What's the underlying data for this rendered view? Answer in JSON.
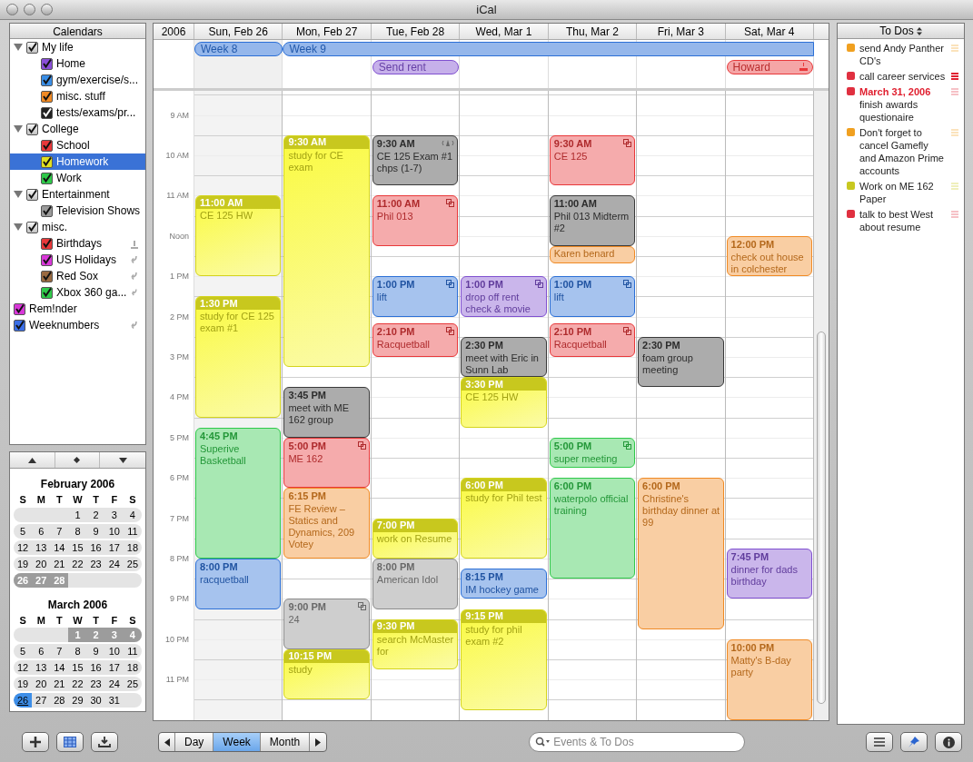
{
  "window": {
    "title": "iCal"
  },
  "calendars": {
    "title": "Calendars",
    "items": [
      {
        "label": "My life",
        "kind": "group",
        "expanded": true,
        "checked": true,
        "selected": false,
        "children": [
          {
            "label": "Home",
            "kind": "local",
            "checked": true,
            "color": "#8a4fd8",
            "selected": false
          },
          {
            "label": "gym/exercise/s...",
            "kind": "local",
            "checked": true,
            "color": "#3a8ee6",
            "selected": false
          },
          {
            "label": "misc. stuff",
            "kind": "local",
            "checked": true,
            "color": "#f08a24",
            "selected": false
          },
          {
            "label": "tests/exams/pr...",
            "kind": "local",
            "checked": true,
            "color": "#222222",
            "selected": false
          }
        ]
      },
      {
        "label": "College",
        "kind": "group",
        "expanded": true,
        "checked": true,
        "selected": false,
        "children": [
          {
            "label": "School",
            "kind": "local",
            "checked": true,
            "color": "#e8383a",
            "selected": false
          },
          {
            "label": "Homework",
            "kind": "local",
            "checked": true,
            "color": "#e0e020",
            "selected": true
          },
          {
            "label": "Work",
            "kind": "local",
            "checked": true,
            "color": "#2fc94a",
            "selected": false
          }
        ]
      },
      {
        "label": "Entertainment",
        "kind": "group",
        "expanded": true,
        "checked": true,
        "selected": false,
        "children": [
          {
            "label": "Television Shows",
            "kind": "local",
            "checked": true,
            "color": "#9a9a9a",
            "selected": false
          }
        ]
      },
      {
        "label": "misc.",
        "kind": "group",
        "expanded": true,
        "checked": true,
        "selected": false,
        "children": [
          {
            "label": "Birthdays",
            "kind": "birthdays",
            "checked": true,
            "color": "#e8383a",
            "selected": false
          },
          {
            "label": "US Holidays",
            "kind": "subscribed",
            "checked": true,
            "color": "#d838d8",
            "selected": false
          },
          {
            "label": "Red Sox",
            "kind": "subscribed",
            "checked": true,
            "color": "#9a6a40",
            "selected": false
          },
          {
            "label": "Xbox 360 ga...",
            "kind": "subscribed",
            "checked": true,
            "color": "#2fc94a",
            "selected": false
          }
        ]
      },
      {
        "label": "Rem!nder",
        "kind": "local",
        "checked": true,
        "color": "#d838d8",
        "selected": false
      },
      {
        "label": "Weeknumbers",
        "kind": "subscribed",
        "checked": true,
        "color": "#3a6ee6",
        "selected": false
      }
    ]
  },
  "mini_calendars": [
    {
      "title": "February 2006",
      "weekdays": [
        "S",
        "M",
        "T",
        "W",
        "T",
        "F",
        "S"
      ],
      "weeks": [
        [
          {
            "label": "1",
            "selected": false,
            "today": false
          },
          {
            "label": "2",
            "selected": false,
            "today": false
          },
          {
            "label": "3",
            "selected": false,
            "today": false
          },
          {
            "label": "4",
            "selected": false,
            "today": false
          }
        ],
        [
          {
            "label": "5",
            "selected": false,
            "today": false
          },
          {
            "label": "6",
            "selected": false,
            "today": false
          },
          {
            "label": "7",
            "selected": false,
            "today": false
          },
          {
            "label": "8",
            "selected": false,
            "today": false
          },
          {
            "label": "9",
            "selected": false,
            "today": false
          },
          {
            "label": "10",
            "selected": false,
            "today": false
          },
          {
            "label": "11",
            "selected": false,
            "today": false
          }
        ],
        [
          {
            "label": "12",
            "selected": false,
            "today": false
          },
          {
            "label": "13",
            "selected": false,
            "today": false
          },
          {
            "label": "14",
            "selected": false,
            "today": false
          },
          {
            "label": "15",
            "selected": false,
            "today": false
          },
          {
            "label": "16",
            "selected": false,
            "today": false
          },
          {
            "label": "17",
            "selected": false,
            "today": false
          },
          {
            "label": "18",
            "selected": false,
            "today": false
          }
        ],
        [
          {
            "label": "19",
            "selected": false,
            "today": false
          },
          {
            "label": "20",
            "selected": false,
            "today": false
          },
          {
            "label": "21",
            "selected": false,
            "today": false
          },
          {
            "label": "22",
            "selected": false,
            "today": false
          },
          {
            "label": "23",
            "selected": false,
            "today": false
          },
          {
            "label": "24",
            "selected": false,
            "today": false
          },
          {
            "label": "25",
            "selected": false,
            "today": false
          }
        ],
        [
          {
            "label": "26",
            "selected": true,
            "today": false
          },
          {
            "label": "27",
            "selected": true,
            "today": false
          },
          {
            "label": "28",
            "selected": true,
            "today": false
          }
        ]
      ]
    },
    {
      "title": "March 2006",
      "weekdays": [
        "S",
        "M",
        "T",
        "W",
        "T",
        "F",
        "S"
      ],
      "weeks": [
        [
          {
            "label": "1",
            "selected": true,
            "today": false
          },
          {
            "label": "2",
            "selected": true,
            "today": false
          },
          {
            "label": "3",
            "selected": true,
            "today": false
          },
          {
            "label": "4",
            "selected": true,
            "today": false
          }
        ],
        [
          {
            "label": "5",
            "selected": false,
            "today": false
          },
          {
            "label": "6",
            "selected": false,
            "today": false
          },
          {
            "label": "7",
            "selected": false,
            "today": false
          },
          {
            "label": "8",
            "selected": false,
            "today": false
          },
          {
            "label": "9",
            "selected": false,
            "today": false
          },
          {
            "label": "10",
            "selected": false,
            "today": false
          },
          {
            "label": "11",
            "selected": false,
            "today": false
          }
        ],
        [
          {
            "label": "12",
            "selected": false,
            "today": false
          },
          {
            "label": "13",
            "selected": false,
            "today": false
          },
          {
            "label": "14",
            "selected": false,
            "today": false
          },
          {
            "label": "15",
            "selected": false,
            "today": false
          },
          {
            "label": "16",
            "selected": false,
            "today": false
          },
          {
            "label": "17",
            "selected": false,
            "today": false
          },
          {
            "label": "18",
            "selected": false,
            "today": false
          }
        ],
        [
          {
            "label": "19",
            "selected": false,
            "today": false
          },
          {
            "label": "20",
            "selected": false,
            "today": false
          },
          {
            "label": "21",
            "selected": false,
            "today": false
          },
          {
            "label": "22",
            "selected": false,
            "today": false
          },
          {
            "label": "23",
            "selected": false,
            "today": false
          },
          {
            "label": "24",
            "selected": false,
            "today": false
          },
          {
            "label": "25",
            "selected": false,
            "today": false
          }
        ],
        [
          {
            "label": "26",
            "selected": false,
            "today": true
          },
          {
            "label": "27",
            "selected": false,
            "today": false
          },
          {
            "label": "28",
            "selected": false,
            "today": false
          },
          {
            "label": "29",
            "selected": false,
            "today": false
          },
          {
            "label": "30",
            "selected": false,
            "today": false
          },
          {
            "label": "31",
            "selected": false,
            "today": false
          }
        ]
      ]
    }
  ],
  "week": {
    "year": "2006",
    "days": [
      {
        "label": "Sun, Feb 26",
        "selected": true
      },
      {
        "label": "Mon, Feb 27",
        "selected": false
      },
      {
        "label": "Tue, Feb 28",
        "selected": false,
        "all_day": [
          {
            "title": "Send rent",
            "color": "#8050d0",
            "birthday": false
          }
        ]
      },
      {
        "label": "Wed, Mar 1",
        "selected": false
      },
      {
        "label": "Thu, Mar 2",
        "selected": false
      },
      {
        "label": "Fri, Mar 3",
        "selected": false
      },
      {
        "label": "Sat, Mar 4",
        "selected": false,
        "all_day": [
          {
            "title": "Howard",
            "color": "#e8383a",
            "birthday": true
          }
        ]
      }
    ],
    "week_banners": [
      {
        "label": "Week 8",
        "color": "#2b6fd6"
      },
      {
        "label": "Week 9",
        "color": "#2b6fd6"
      }
    ],
    "hours": [
      "9 AM",
      "10 AM",
      "11 AM",
      "Noon",
      "1 PM",
      "2 PM",
      "3 PM",
      "4 PM",
      "5 PM",
      "6 PM",
      "7 PM",
      "8 PM",
      "9 PM",
      "10 PM",
      "11 PM"
    ],
    "events": [
      [
        {
          "time": "11:00 AM",
          "title": "CE 125 HW",
          "color": "#d4d41c",
          "highlighted": true,
          "recurring": false,
          "alarm": false
        },
        {
          "time": "1:30 PM",
          "title": "study for CE 125 exam #1",
          "color": "#d4d41c",
          "highlighted": true,
          "recurring": false,
          "alarm": false
        },
        {
          "time": "4:45 PM",
          "title": "Superive Basketball",
          "color": "#2fc94a",
          "highlighted": false,
          "recurring": false,
          "alarm": false
        },
        {
          "time": "8:00 PM",
          "title": "racquetball",
          "color": "#2b6fd6",
          "highlighted": false,
          "recurring": false,
          "alarm": false
        }
      ],
      [
        {
          "time": "9:30 AM",
          "title": "study for CE exam",
          "color": "#d4d41c",
          "highlighted": true,
          "recurring": false,
          "alarm": false
        },
        {
          "time": "3:45 PM",
          "title": "meet with ME 162 group",
          "color": "#3a3a3a",
          "highlighted": false,
          "recurring": false,
          "alarm": false
        },
        {
          "time": "5:00 PM",
          "title": "ME 162",
          "color": "#e8383a",
          "highlighted": false,
          "recurring": true,
          "alarm": false
        },
        {
          "time": "6:15 PM",
          "title": "FE Review – Statics and Dynamics, 209 Votey",
          "color": "#f08a24",
          "highlighted": false,
          "recurring": false,
          "alarm": false
        },
        {
          "time": "9:00 PM",
          "title": "24",
          "color": "#8a8a8a",
          "highlighted": false,
          "recurring": true,
          "alarm": false
        },
        {
          "time": "10:15 PM",
          "title": "study",
          "color": "#d4d41c",
          "highlighted": true,
          "recurring": false,
          "alarm": false
        }
      ],
      [
        {
          "time": "9:30 AM",
          "title": "CE 125 Exam #1 chps (1-7)",
          "color": "#3a3a3a",
          "highlighted": false,
          "recurring": false,
          "alarm": true
        },
        {
          "time": "11:00 AM",
          "title": "Phil 013",
          "color": "#e8383a",
          "highlighted": false,
          "recurring": true,
          "alarm": false
        },
        {
          "time": "1:00 PM",
          "title": "lift",
          "color": "#2b6fd6",
          "highlighted": false,
          "recurring": true,
          "alarm": false
        },
        {
          "time": "2:10 PM",
          "title": "Racquetball",
          "color": "#e8383a",
          "highlighted": false,
          "recurring": true,
          "alarm": false
        },
        {
          "time": "7:00 PM",
          "title": "work on Resume",
          "color": "#d4d41c",
          "highlighted": true,
          "recurring": false,
          "alarm": false
        },
        {
          "time": "8:00 PM",
          "title": "American Idol",
          "color": "#8a8a8a",
          "highlighted": false,
          "recurring": false,
          "alarm": false
        },
        {
          "time": "9:30 PM",
          "title": "search McMaster for",
          "color": "#d4d41c",
          "highlighted": true,
          "recurring": false,
          "alarm": false
        }
      ],
      [
        {
          "time": "1:00 PM",
          "title": "drop off rent check & movie",
          "color": "#8050d0",
          "highlighted": false,
          "recurring": true,
          "alarm": false
        },
        {
          "time": "2:30 PM",
          "title": "meet with Eric in Sunn Lab",
          "color": "#3a3a3a",
          "highlighted": false,
          "recurring": false,
          "alarm": false
        },
        {
          "time": "3:30 PM",
          "title": "CE 125 HW",
          "color": "#d4d41c",
          "highlighted": true,
          "recurring": false,
          "alarm": false
        },
        {
          "time": "6:00 PM",
          "title": "study for Phil test",
          "color": "#d4d41c",
          "highlighted": true,
          "recurring": false,
          "alarm": false
        },
        {
          "time": "8:15 PM",
          "title": "IM hockey game",
          "color": "#2b6fd6",
          "highlighted": false,
          "recurring": false,
          "alarm": false
        },
        {
          "time": "9:15 PM",
          "title": "study for phil exam #2",
          "color": "#d4d41c",
          "highlighted": true,
          "recurring": false,
          "alarm": false
        }
      ],
      [
        {
          "time": "9:30 AM",
          "title": "CE 125",
          "color": "#e8383a",
          "highlighted": false,
          "recurring": true,
          "alarm": false
        },
        {
          "time": "11:00 AM",
          "title": "Phil 013 Midterm #2",
          "color": "#3a3a3a",
          "highlighted": false,
          "recurring": false,
          "alarm": false
        },
        {
          "title": "Karen benard",
          "color": "#f08a24",
          "highlighted": false,
          "recurring": false,
          "alarm": false
        },
        {
          "time": "1:00 PM",
          "title": "lift",
          "color": "#2b6fd6",
          "highlighted": false,
          "recurring": true,
          "alarm": false
        },
        {
          "time": "2:10 PM",
          "title": "Racquetball",
          "color": "#e8383a",
          "highlighted": false,
          "recurring": true,
          "alarm": false
        },
        {
          "time": "5:00 PM",
          "title": "super meeting",
          "color": "#2fc94a",
          "highlighted": false,
          "recurring": true,
          "alarm": false
        },
        {
          "time": "6:00 PM",
          "title": "waterpolo official training",
          "color": "#2fc94a",
          "highlighted": false,
          "recurring": false,
          "alarm": false
        }
      ],
      [
        {
          "time": "2:30 PM",
          "title": "foam group meeting",
          "color": "#3a3a3a",
          "highlighted": false,
          "recurring": false,
          "alarm": false
        },
        {
          "time": "6:00 PM",
          "title": "Christine's birthday dinner at 99",
          "color": "#f08a24",
          "highlighted": false,
          "recurring": false,
          "alarm": false
        }
      ],
      [
        {
          "time": "12:00 PM",
          "title": "check out house in colchester",
          "color": "#f08a24",
          "highlighted": false,
          "recurring": false,
          "alarm": false
        },
        {
          "time": "7:45 PM",
          "title": "dinner for dads birthday",
          "color": "#8050d0",
          "highlighted": false,
          "recurring": false,
          "alarm": false
        },
        {
          "time": "10:00 PM",
          "title": "Matty's B-day party",
          "color": "#f08a24",
          "highlighted": false,
          "recurring": false,
          "alarm": false
        }
      ]
    ]
  },
  "todos": {
    "title": "To Dos",
    "items": [
      {
        "text": "send Andy Panther CD's",
        "color": "#f0a020",
        "urgent": false
      },
      {
        "text": "call career services",
        "color": "#e03040",
        "urgent": true
      },
      {
        "due": "March 31, 2006",
        "text": "finish awards questionaire",
        "color": "#e03040",
        "urgent": false
      },
      {
        "text": "Don't forget to cancel Gamefly and Amazon Prime accounts",
        "color": "#f0a020",
        "urgent": false
      },
      {
        "text": "Work on ME 162 Paper",
        "color": "#c8c820",
        "urgent": false
      },
      {
        "text": "talk to best West about resume",
        "color": "#e03040",
        "urgent": false
      }
    ]
  },
  "toolbar": {
    "views": [
      {
        "label": "Day",
        "selected": false
      },
      {
        "label": "Week",
        "selected": true
      },
      {
        "label": "Month",
        "selected": false
      }
    ],
    "search": {
      "placeholder": "Events & To Dos"
    }
  }
}
